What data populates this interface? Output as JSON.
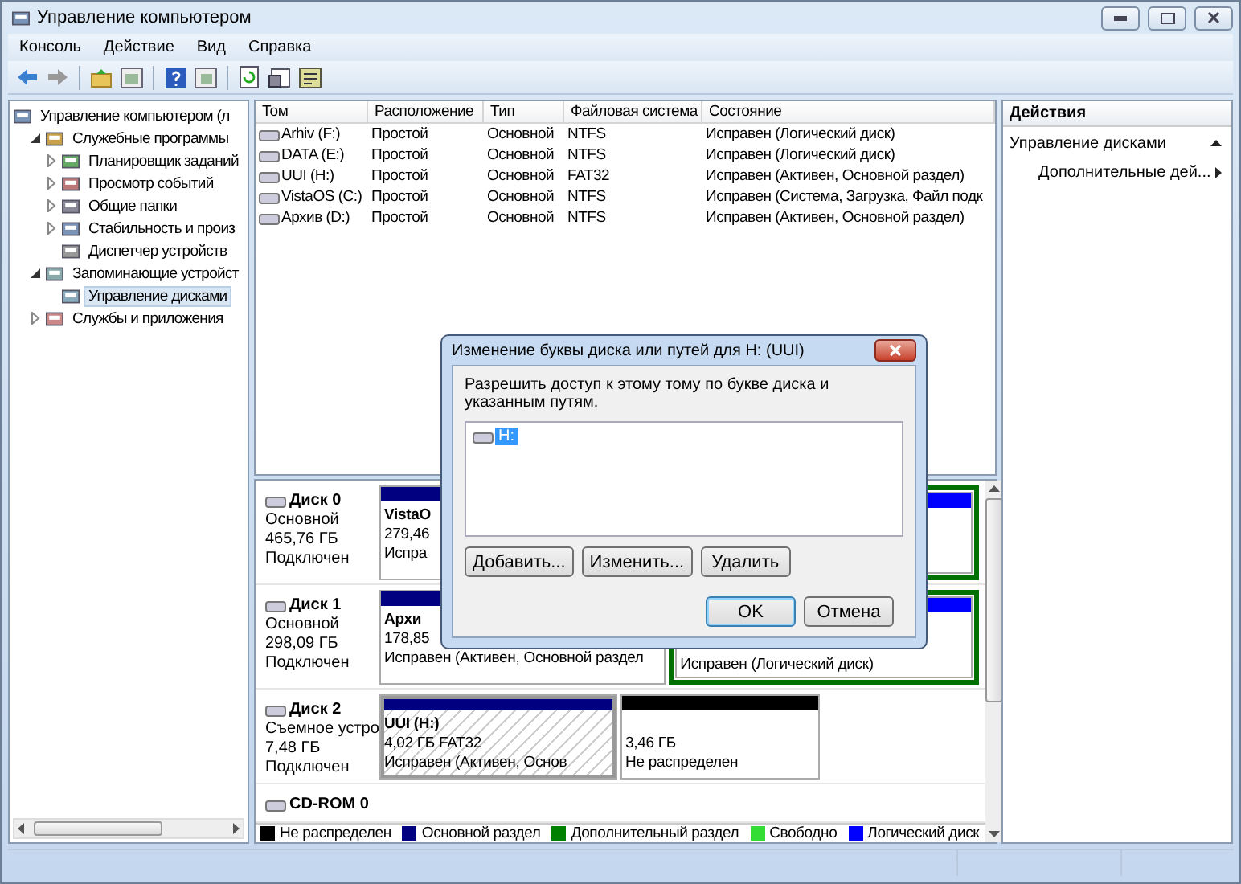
{
  "window": {
    "title": "Управление компьютером"
  },
  "menu": [
    "Консоль",
    "Действие",
    "Вид",
    "Справка"
  ],
  "tree": [
    {
      "label": "Управление компьютером (л",
      "selected": false,
      "children": [
        {
          "label": "Служебные программы",
          "selected": false,
          "expanded": true,
          "children": [
            {
              "label": "Планировщик заданий",
              "selected": false,
              "expanded": false
            },
            {
              "label": "Просмотр событий",
              "selected": false,
              "expanded": false
            },
            {
              "label": "Общие папки",
              "selected": false,
              "expanded": false
            },
            {
              "label": "Стабильность и произ",
              "selected": false,
              "expanded": false
            },
            {
              "label": "Диспетчер устройств",
              "selected": false
            }
          ]
        },
        {
          "label": "Запоминающие устройст",
          "selected": false,
          "expanded": true,
          "children": [
            {
              "label": "Управление дисками",
              "selected": true
            }
          ]
        },
        {
          "label": "Службы и приложения",
          "selected": false,
          "expanded": false
        }
      ]
    }
  ],
  "table": {
    "columns": [
      "Том",
      "Расположение",
      "Тип",
      "Файловая система",
      "Состояние"
    ],
    "rows": [
      [
        "Arhiv (F:)",
        "Простой",
        "Основной",
        "NTFS",
        "Исправен (Логический диск)"
      ],
      [
        "DATA (E:)",
        "Простой",
        "Основной",
        "NTFS",
        "Исправен (Логический диск)"
      ],
      [
        "UUI (H:)",
        "Простой",
        "Основной",
        "FAT32",
        "Исправен (Активен, Основной раздел)"
      ],
      [
        "VistaOS (C:)",
        "Простой",
        "Основной",
        "NTFS",
        "Исправен (Система, Загрузка, Файл подк"
      ],
      [
        "Архив (D:)",
        "Простой",
        "Основной",
        "NTFS",
        "Исправен (Активен, Основной раздел)"
      ]
    ]
  },
  "disks": [
    {
      "name": "Диск 0",
      "type": "Основной",
      "size": "465,76 ГБ",
      "status": "Подключен",
      "partitions": [
        {
          "kind": "primary",
          "name": "VistaO",
          "size": "279,46",
          "status": "Испра"
        },
        {
          "kind": "extended",
          "children": [
            {
              "kind": "logical"
            }
          ]
        }
      ]
    },
    {
      "name": "Диск 1",
      "type": "Основной",
      "size": "298,09 ГБ",
      "status": "Подключен",
      "partitions": [
        {
          "kind": "primary",
          "name": "Архи",
          "size": "178,85",
          "status": "Исправен (Активен, Основной раздел"
        },
        {
          "kind": "extended",
          "children": [
            {
              "kind": "logical",
              "status": "Исправен (Логический диск)"
            }
          ]
        }
      ]
    },
    {
      "name": "Диск 2",
      "type": "Съемное устро",
      "size": "7,48 ГБ",
      "status": "Подключен",
      "partitions": [
        {
          "kind": "primary",
          "selected": true,
          "name": "UUI  (H:)",
          "size": "4,02 ГБ FAT32",
          "status": "Исправен (Активен, Основ"
        },
        {
          "kind": "unallocated",
          "selected": false,
          "size": "3,46 ГБ",
          "status": "Не распределен"
        }
      ]
    },
    {
      "name": "CD-ROM 0"
    }
  ],
  "legend": [
    {
      "label": "Не распределен",
      "color": "#000000"
    },
    {
      "label": "Основной раздел",
      "color": "#000080"
    },
    {
      "label": "Дополнительный раздел",
      "color": "#008000"
    },
    {
      "label": "Свободно",
      "color": "#33dd33"
    },
    {
      "label": "Логический диск",
      "color": "#0000ff"
    }
  ],
  "actions": {
    "title": "Действия",
    "section": "Управление дисками",
    "items": [
      "Дополнительные дей..."
    ]
  },
  "dialog": {
    "title": "Изменение буквы диска или путей для H: (UUI)",
    "text": "Разрешить доступ к этому тому по букве диска и указанным путям.",
    "paths": [
      {
        "label": "H:",
        "selected": true
      }
    ],
    "buttons": [
      "Добавить...",
      "Изменить...",
      "Удалить"
    ],
    "footer": [
      {
        "label": "OK",
        "default": true
      },
      {
        "label": "Отмена",
        "default": false
      }
    ]
  }
}
